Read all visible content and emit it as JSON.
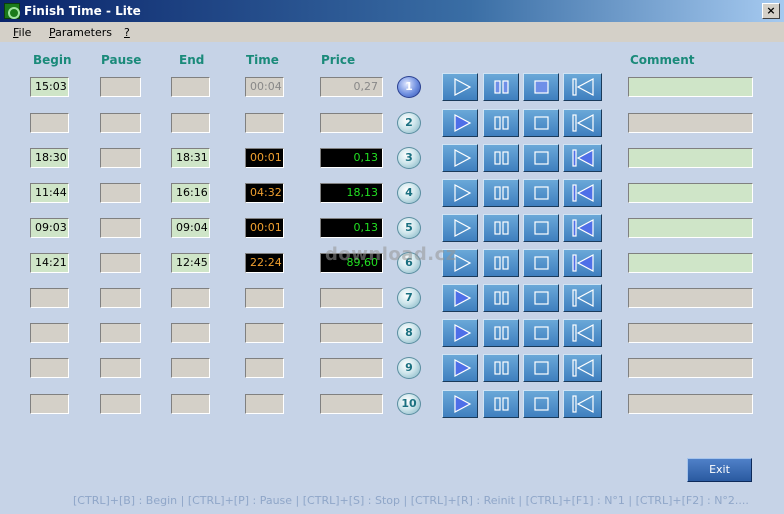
{
  "window": {
    "title": "Finish Time - Lite",
    "close_glyph": "×"
  },
  "menu": [
    {
      "underline": "F",
      "rest": "ile"
    },
    {
      "underline": "P",
      "rest": "arameters"
    },
    {
      "underline": "?",
      "rest": ""
    }
  ],
  "headers": {
    "begin": "Begin",
    "pause": "Pause",
    "end": "End",
    "time": "Time",
    "price": "Price",
    "comment": "Comment"
  },
  "rows": [
    {
      "num": "1",
      "begin": "15:03",
      "pause": "",
      "end": "",
      "time": "00:04",
      "price": "0,27",
      "comment": "",
      "state": "active"
    },
    {
      "num": "2",
      "begin": "",
      "pause": "",
      "end": "",
      "time": "",
      "price": "",
      "comment": "",
      "state": "idle"
    },
    {
      "num": "3",
      "begin": "18:30",
      "pause": "",
      "end": "18:31",
      "time": "00:01",
      "price": "0,13",
      "comment": "",
      "state": "done"
    },
    {
      "num": "4",
      "begin": "11:44",
      "pause": "",
      "end": "16:16",
      "time": "04:32",
      "price": "18,13",
      "comment": "",
      "state": "done"
    },
    {
      "num": "5",
      "begin": "09:03",
      "pause": "",
      "end": "09:04",
      "time": "00:01",
      "price": "0,13",
      "comment": "",
      "state": "done"
    },
    {
      "num": "6",
      "begin": "14:21",
      "pause": "",
      "end": "12:45",
      "time": "22:24",
      "price": "89,60",
      "comment": "",
      "state": "done"
    },
    {
      "num": "7",
      "begin": "",
      "pause": "",
      "end": "",
      "time": "",
      "price": "",
      "comment": "",
      "state": "idle"
    },
    {
      "num": "8",
      "begin": "",
      "pause": "",
      "end": "",
      "time": "",
      "price": "",
      "comment": "",
      "state": "idle"
    },
    {
      "num": "9",
      "begin": "",
      "pause": "",
      "end": "",
      "time": "",
      "price": "",
      "comment": "",
      "state": "idle"
    },
    {
      "num": "10",
      "begin": "",
      "pause": "",
      "end": "",
      "time": "",
      "price": "",
      "comment": "",
      "state": "idle"
    }
  ],
  "buttons": {
    "exit": "Exit"
  },
  "shortcuts": "[CTRL]+[B] : Begin   |   [CTRL]+[P] : Pause   |   [CTRL]+[S] : Stop   |   [CTRL]+[R] : Reinit   |   [CTRL]+[F1] : N°1   |   [CTRL]+[F2] : N°2....",
  "watermark": "download.cz",
  "colors": {
    "titlebar": "#0a246a",
    "client_bg": "#c6d3e7",
    "header_teal": "#1a8a7a",
    "button_blue": "#3f7fbf",
    "time_orange": "#f0a030",
    "price_green": "#22e022",
    "field_green": "#cfe5c8"
  }
}
